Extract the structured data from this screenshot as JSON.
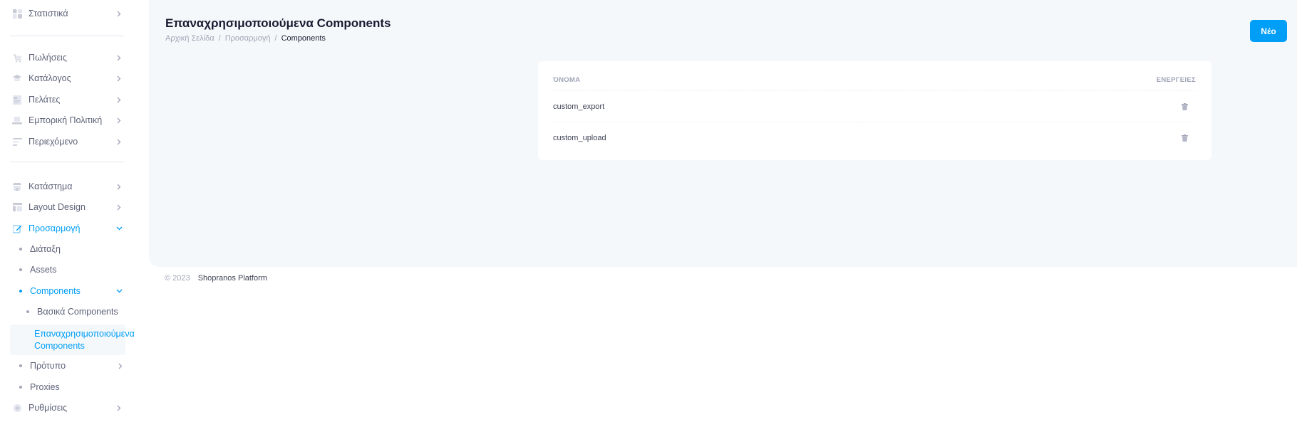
{
  "sidebar": {
    "items": [
      {
        "label": "Στατιστικά",
        "icon": "chart-icon"
      },
      {
        "label": "Πωλήσεις",
        "icon": "cart-icon"
      },
      {
        "label": "Κατάλογος",
        "icon": "catalog-icon"
      },
      {
        "label": "Πελάτες",
        "icon": "customers-icon"
      },
      {
        "label": "Εμπορική Πολιτική",
        "icon": "policy-icon"
      },
      {
        "label": "Περιεχόμενο",
        "icon": "content-icon"
      },
      {
        "label": "Κατάστημα",
        "icon": "store-icon"
      },
      {
        "label": "Layout Design",
        "icon": "layout-icon"
      },
      {
        "label": "Προσαρμογή",
        "icon": "edit-icon"
      }
    ],
    "customization_sub": [
      {
        "label": "Διάταξη"
      },
      {
        "label": "Assets"
      },
      {
        "label": "Components"
      }
    ],
    "components_sub": [
      {
        "label": "Βασικά Components"
      },
      {
        "label_line1": "Επαναχρησιμοποιούμενα",
        "label_line2": "Components"
      }
    ],
    "more_sub": [
      {
        "label": "Πρότυπο"
      },
      {
        "label": "Proxies"
      }
    ],
    "settings": {
      "label": "Ρυθμίσεις",
      "icon": "gear-icon"
    }
  },
  "header": {
    "title": "Επαναχρησιμοποιούμενα Components",
    "breadcrumb": [
      "Αρχική Σελίδα",
      "Προσαρμογή",
      "Components"
    ],
    "new_button": "Νέο"
  },
  "table": {
    "columns": [
      "ΌΝΟΜΑ",
      "ΕΝΕΡΓΕΙΕΣ"
    ],
    "rows": [
      {
        "name": "custom_export"
      },
      {
        "name": "custom_upload"
      }
    ]
  },
  "footer": {
    "year": "© 2023",
    "brand": "Shopranos Platform"
  },
  "colors": {
    "accent": "#009ef7",
    "muted": "#a1a5b7",
    "text": "#5e6278",
    "content_bg": "#f5f8fa"
  }
}
